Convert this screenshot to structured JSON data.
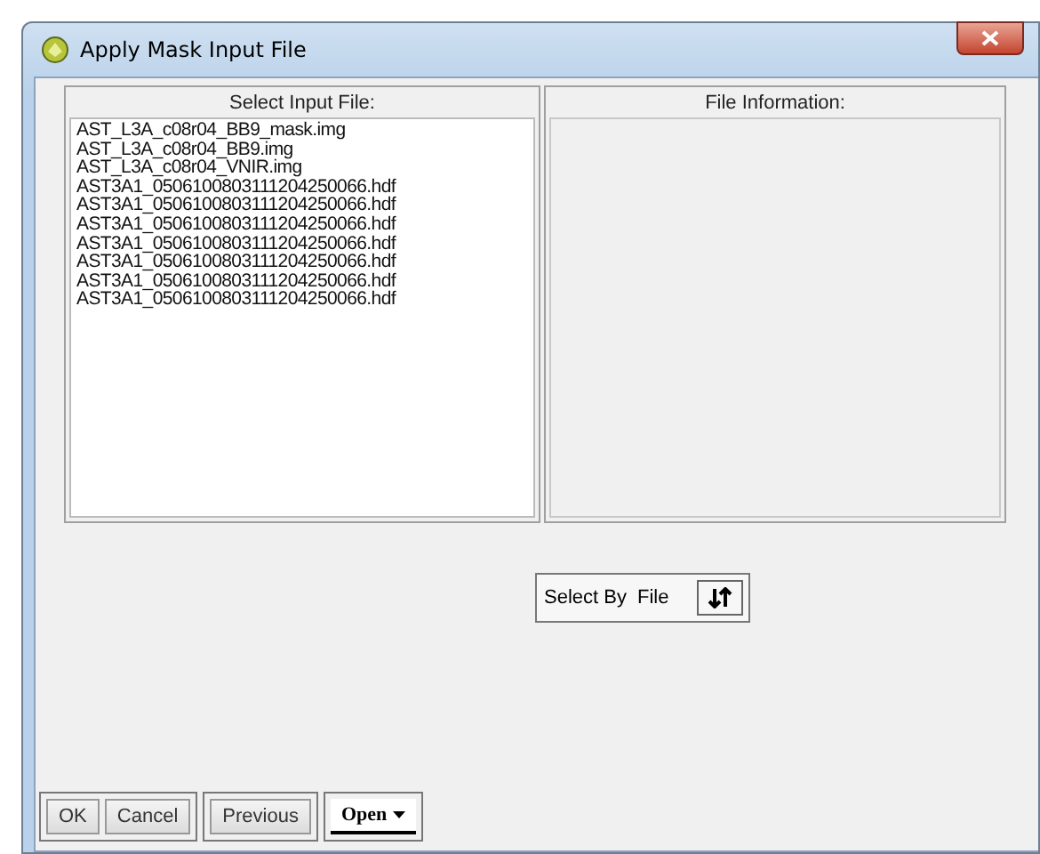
{
  "window": {
    "title": "Apply Mask Input File"
  },
  "input_panel": {
    "header": "Select Input File:",
    "files": [
      "AST_L3A_c08r04_BB9_mask.img",
      "AST_L3A_c08r04_BB9.img",
      "AST_L3A_c08r04_VNIR.img",
      "AST3A1_0506100803111204250066.hdf",
      "AST3A1_0506100803111204250066.hdf",
      "AST3A1_0506100803111204250066.hdf",
      "AST3A1_0506100803111204250066.hdf",
      "AST3A1_0506100803111204250066.hdf",
      "AST3A1_0506100803111204250066.hdf",
      "AST3A1_0506100803111204250066.hdf"
    ]
  },
  "info_panel": {
    "header": "File Information:"
  },
  "select_by": {
    "label": "Select By",
    "value": "File"
  },
  "button_groups": [
    [
      {
        "label": "OK",
        "kind": "plain"
      },
      {
        "label": "Cancel",
        "kind": "plain"
      }
    ],
    [
      {
        "label": "Previous",
        "kind": "plain"
      }
    ],
    [
      {
        "label": "Open",
        "kind": "menu"
      }
    ]
  ]
}
